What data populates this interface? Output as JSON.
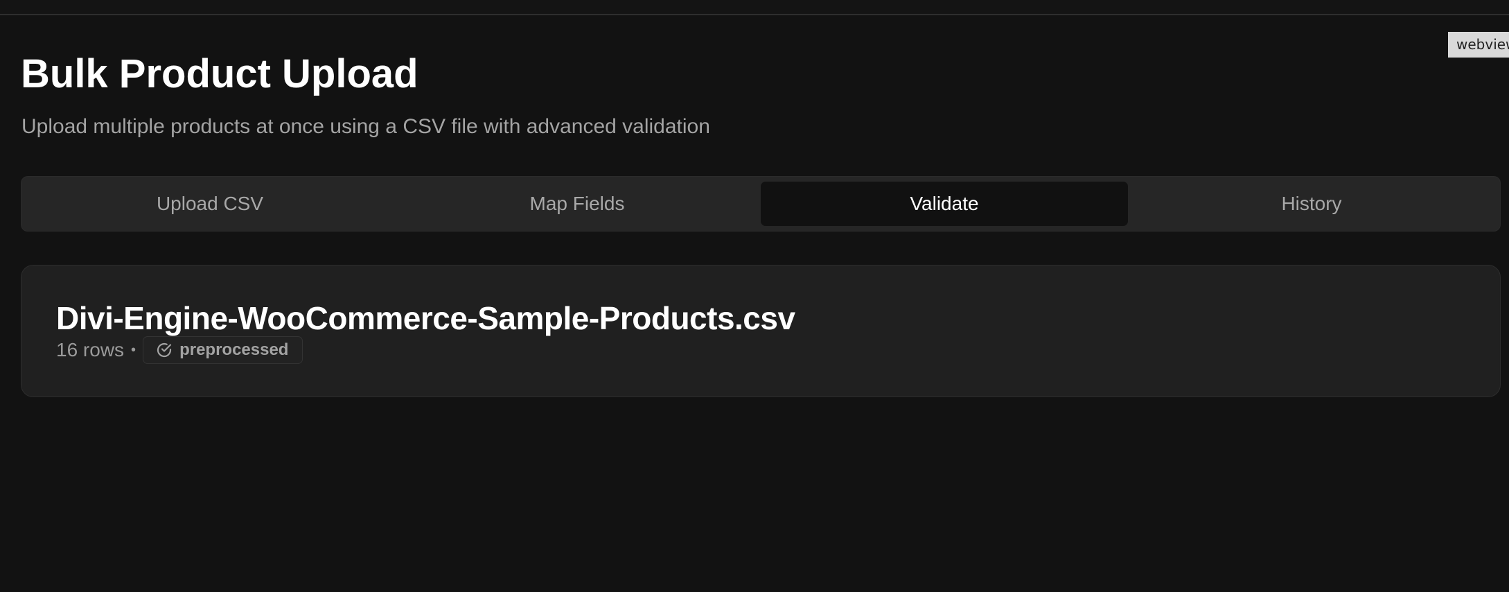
{
  "webview_label": "webview",
  "page": {
    "title": "Bulk Product Upload",
    "subtitle": "Upload multiple products at once using a CSV file with advanced validation"
  },
  "tabs": [
    {
      "label": "Upload CSV",
      "active": false
    },
    {
      "label": "Map Fields",
      "active": false
    },
    {
      "label": "Validate",
      "active": true
    },
    {
      "label": "History",
      "active": false
    }
  ],
  "file": {
    "name": "Divi-Engine-WooCommerce-Sample-Products.csv",
    "rows": "16 rows",
    "separator": "•",
    "status": {
      "label": "preprocessed",
      "icon": "check-circle-icon"
    }
  },
  "colors": {
    "background": "#121212",
    "tab_bar": "#262626",
    "active_tab": "#111111",
    "card": "#202020",
    "muted_text": "#a4a4a4"
  }
}
